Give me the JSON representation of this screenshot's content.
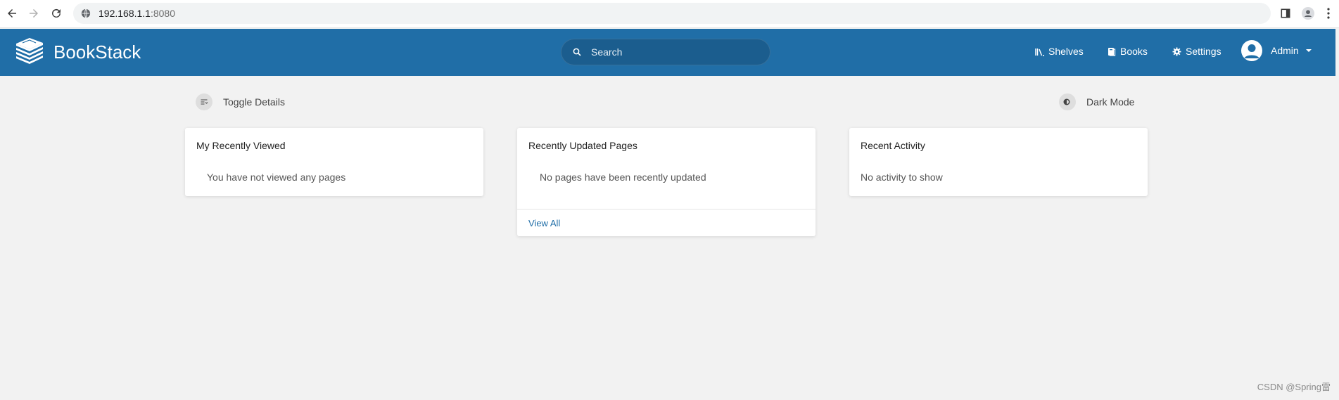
{
  "browser": {
    "url_host": "192.168.1.1",
    "url_port": ":8080",
    "icons": [
      "back-arrow-icon",
      "forward-arrow-icon",
      "reload-icon",
      "site-info-icon",
      "sidebar-icon",
      "profile-icon",
      "more-vert-icon"
    ]
  },
  "header": {
    "brand": "BookStack",
    "search_placeholder": "Search",
    "nav": {
      "shelves": "Shelves",
      "books": "Books",
      "settings": "Settings"
    },
    "user": "Admin"
  },
  "toolbar": {
    "toggle_details": "Toggle Details",
    "dark_mode": "Dark Mode"
  },
  "cards": {
    "recently_viewed": {
      "title": "My Recently Viewed",
      "empty": "You have not viewed any pages"
    },
    "recently_updated": {
      "title": "Recently Updated Pages",
      "empty": "No pages have been recently updated",
      "link": "View All"
    },
    "recent_activity": {
      "title": "Recent Activity",
      "empty": "No activity to show"
    }
  },
  "watermark": "CSDN @Spring雷",
  "colors": {
    "header": "#206ea7",
    "background": "#f2f2f2",
    "link": "#206ea7"
  }
}
